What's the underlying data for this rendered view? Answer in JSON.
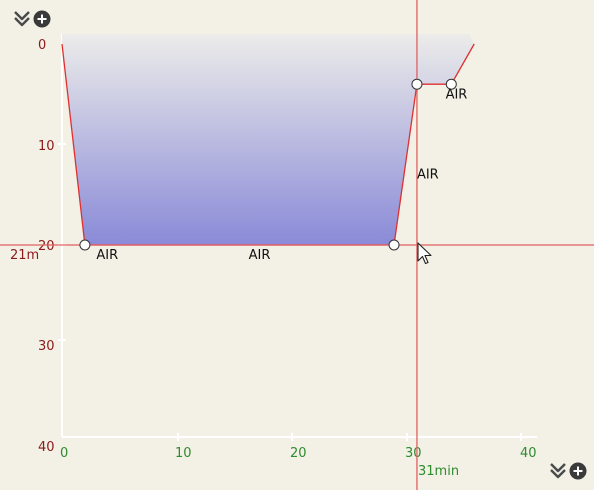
{
  "planner": {
    "y_ticks": [
      "0",
      "10",
      "20",
      "30",
      "40"
    ],
    "x_ticks": [
      "0",
      "10",
      "20",
      "30",
      "40"
    ],
    "cursor_depth_label": "21m",
    "cursor_time_label": "31min",
    "gas_labels": [
      "AIR",
      "AIR",
      "AIR",
      "AIR"
    ]
  },
  "chart_data": {
    "type": "area",
    "xlabel": "",
    "ylabel": "",
    "xlim": [
      0,
      41
    ],
    "ylim": [
      0,
      40
    ],
    "y_inverted": true,
    "x_ticks": [
      0,
      10,
      20,
      30,
      40
    ],
    "y_ticks": [
      0,
      10,
      20,
      30,
      40
    ],
    "profile_points": [
      {
        "time": 0,
        "depth": 0
      },
      {
        "time": 2,
        "depth": 20
      },
      {
        "time": 29,
        "depth": 20
      },
      {
        "time": 31,
        "depth": 4
      },
      {
        "time": 34,
        "depth": 4
      },
      {
        "time": 36,
        "depth": 0
      }
    ],
    "waypoints": [
      {
        "time": 2,
        "depth": 20
      },
      {
        "time": 29,
        "depth": 20
      },
      {
        "time": 31,
        "depth": 4
      },
      {
        "time": 34,
        "depth": 4
      }
    ],
    "gas_annotations": [
      {
        "text": "AIR",
        "time": 3,
        "depth": 21
      },
      {
        "text": "AIR",
        "time": 16.3,
        "depth": 21
      },
      {
        "text": "AIR",
        "time": 31,
        "depth": 13
      },
      {
        "text": "AIR",
        "time": 33.5,
        "depth": 5
      }
    ],
    "cursor": {
      "time": 31,
      "depth": 20
    },
    "colors": {
      "profile_line": "#e03030",
      "fill_top": "#ececea",
      "fill_bottom": "#8a8ad8",
      "y_tick": "#8b1a1a",
      "x_tick": "#2e8b2e",
      "axis": "#ffffff",
      "cursor": "#e06060"
    }
  }
}
